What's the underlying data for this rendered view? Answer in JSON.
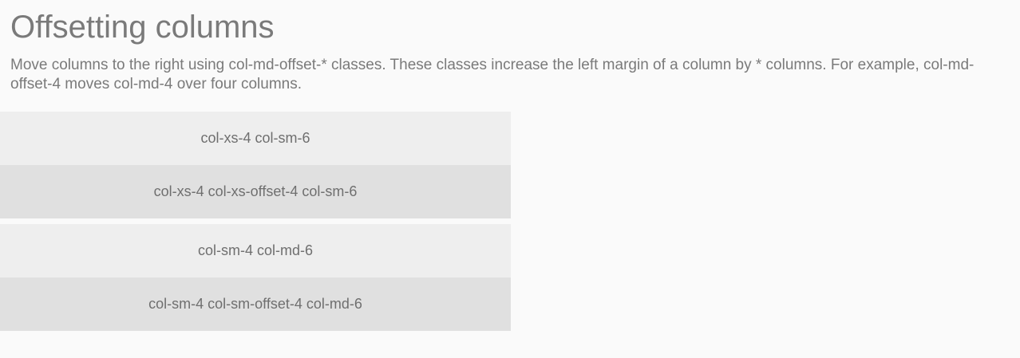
{
  "header": {
    "title": "Offsetting columns",
    "description": "Move columns to the right using col-md-offset-* classes. These classes increase the left margin of a column by * columns. For example, col-md-offset-4 moves col-md-4 over four columns."
  },
  "rows": [
    {
      "cells": [
        "col-xs-4 col-sm-6",
        "col-xs-4 col-xs-offset-4 col-sm-6"
      ]
    },
    {
      "cells": [
        "col-sm-4 col-md-6",
        "col-sm-4 col-sm-offset-4 col-md-6"
      ]
    }
  ],
  "colors": {
    "background": "#fafafa",
    "cell_light": "#eeeeee",
    "cell_dark": "#e0e0e0",
    "text": "#757575"
  }
}
